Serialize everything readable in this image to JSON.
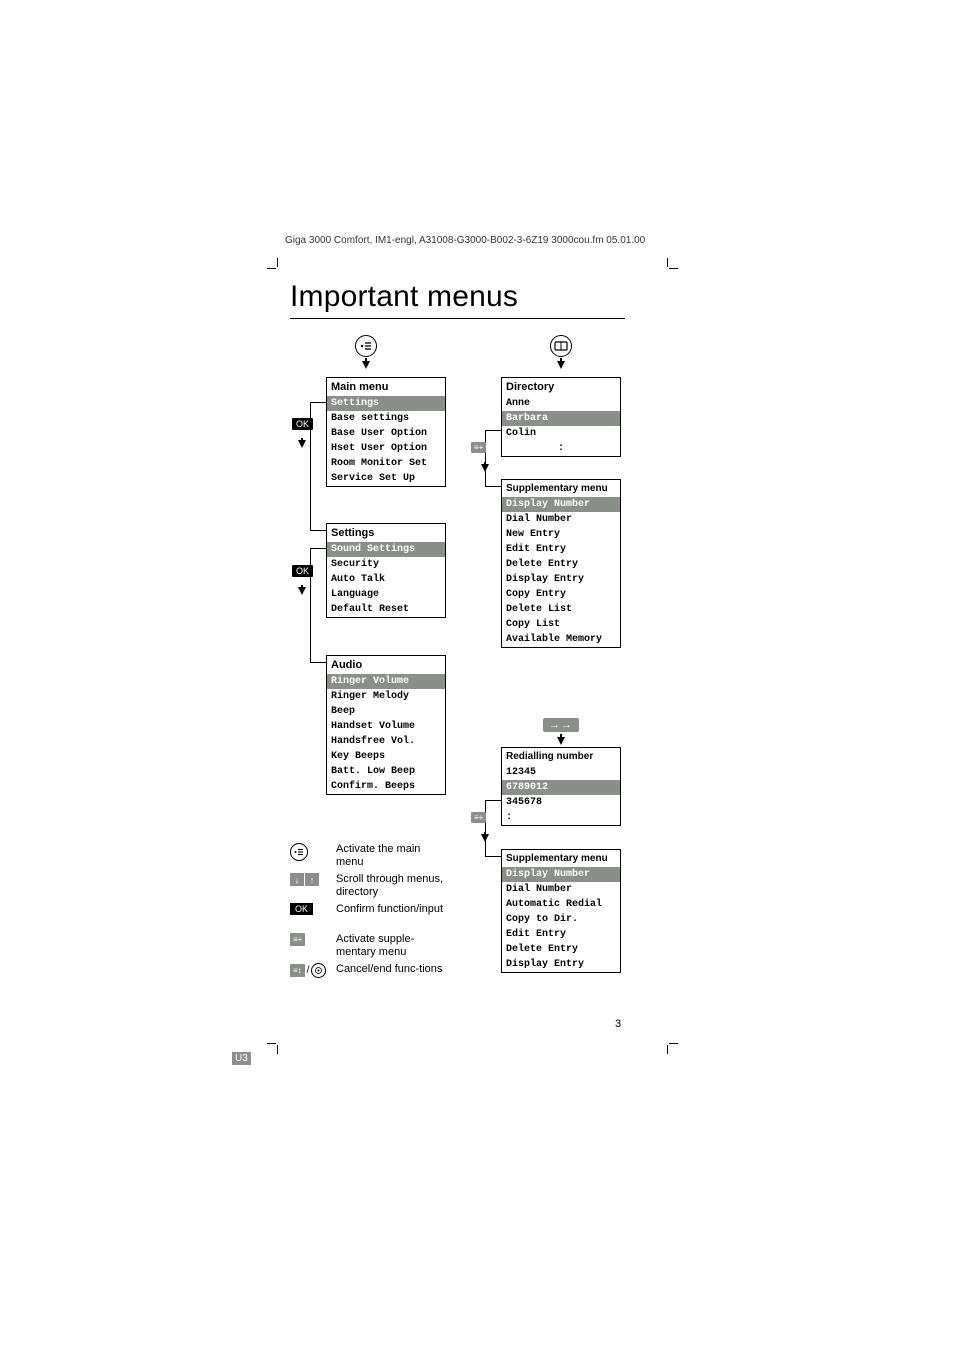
{
  "meta": {
    "header": "Giga 3000 Comfort, IM1-engl, A31008-G3000-B002-3-6Z19  3000cou.fm     05.01.00",
    "title": "Important menus",
    "page_number": "3",
    "corner_badge": "U3"
  },
  "left": {
    "main_menu": {
      "title": "Main menu",
      "items": [
        "Settings",
        "Base settings",
        "Base User Option",
        "Hset User Option",
        "Room Monitor Set",
        "Service Set Up"
      ],
      "selected": 0
    },
    "settings": {
      "title": "Settings",
      "items": [
        "Sound Settings",
        "Security",
        "Auto Talk",
        "Language",
        "Default Reset"
      ],
      "selected": 0
    },
    "audio": {
      "title": "Audio",
      "items": [
        "Ringer Volume",
        "Ringer Melody",
        "Beep",
        "Handset Volume",
        "Handsfree Vol.",
        "Key Beeps",
        "Batt. Low Beep",
        "Confirm. Beeps"
      ],
      "selected": 0
    }
  },
  "right": {
    "directory": {
      "title": "Directory",
      "items": [
        "Anne",
        "Barbara",
        "Colin",
        ":"
      ],
      "selected": 1
    },
    "supp1": {
      "title": "Supplementary menu",
      "items": [
        "Display Number",
        "Dial Number",
        "New Entry",
        "Edit Entry",
        "Delete Entry",
        "Display Entry",
        "Copy Entry",
        "Delete List",
        "Copy List",
        "Available Memory"
      ],
      "selected": 0
    },
    "redial": {
      "title": "Redialling number",
      "items": [
        "12345",
        "6789012",
        "345678",
        ":"
      ],
      "selected": 1
    },
    "supp2": {
      "title": "Supplementary menu",
      "items": [
        "Display Number",
        "Dial Number",
        "Automatic Redial",
        "Copy to Dir.",
        "Edit Entry",
        "Delete Entry",
        "Display Entry"
      ],
      "selected": 0
    }
  },
  "legend": {
    "row1": "Activate the main menu",
    "row2": "Scroll through menus, directory",
    "row3": "Confirm function/input",
    "row4": "Activate supple-mentary menu",
    "row5": "Cancel/end func-tions",
    "ok": "OK"
  },
  "icons": {
    "menu": "≡",
    "book": "▭",
    "arrows": "→→",
    "down": "↓",
    "up": "↑",
    "supp": "≡+",
    "back": "≡↕",
    "end": "⌂"
  }
}
